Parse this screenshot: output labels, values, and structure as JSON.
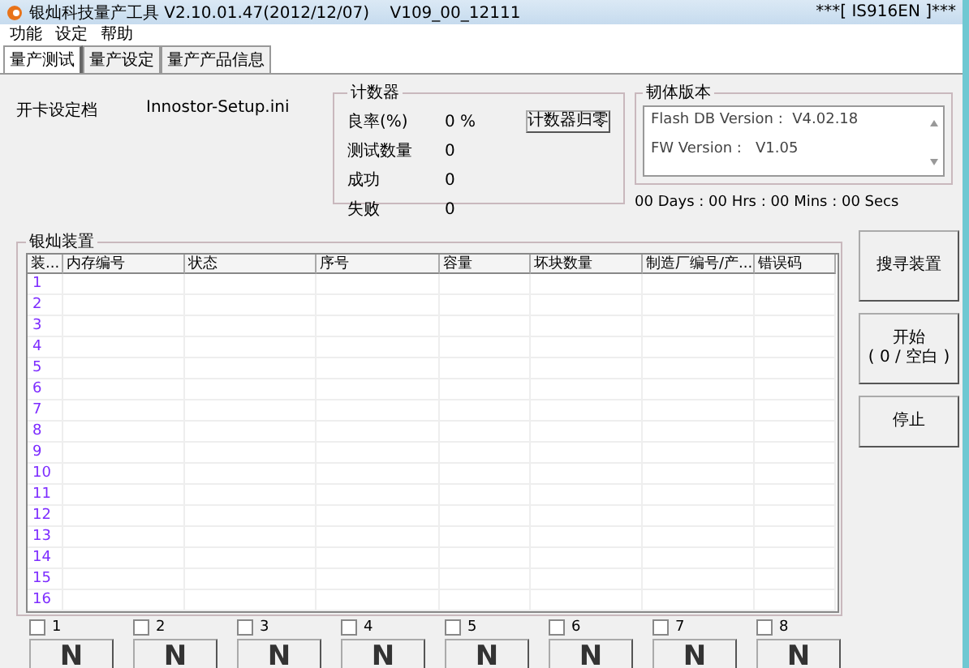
{
  "window": {
    "title": "银灿科技量产工具 V2.10.01.47(2012/12/07)    V109_00_12111",
    "title_right": "***[ IS916EN ]***"
  },
  "menu": [
    "功能",
    "设定",
    "帮助"
  ],
  "tabs": [
    {
      "label": "量产测试",
      "selected": true
    },
    {
      "label": "量产设定",
      "selected": false
    },
    {
      "label": "量产产品信息",
      "selected": false
    }
  ],
  "config": {
    "label": "开卡设定档",
    "value": "Innostor-Setup.ini"
  },
  "counter": {
    "title": "计数器",
    "reset_button": "计数器归零",
    "rows": [
      {
        "label": "良率(%)",
        "value": "0 %"
      },
      {
        "label": "测试数量",
        "value": "0"
      },
      {
        "label": "成功",
        "value": "0"
      },
      {
        "label": "失败",
        "value": "0"
      }
    ]
  },
  "firmware": {
    "title": "韧体版本",
    "lines": [
      "Flash DB Version :  V4.02.18",
      "FW Version :   V1.05"
    ]
  },
  "timer": "00 Days : 00 Hrs : 00 Mins : 00 Secs",
  "devices": {
    "title": "银灿装置",
    "columns": [
      "装...",
      "内存编号",
      "状态",
      "序号",
      "容量",
      "坏块数量",
      "制造厂编号/产...",
      "错误码"
    ],
    "rows": [
      "1",
      "2",
      "3",
      "4",
      "5",
      "6",
      "7",
      "8",
      "9",
      "10",
      "11",
      "12",
      "13",
      "14",
      "15",
      "16"
    ]
  },
  "buttons": [
    "搜寻装置",
    "开始\n( 0 / 空白 )",
    "停止"
  ],
  "slots": [
    {
      "label": "1",
      "checked": false,
      "button": "N"
    },
    {
      "label": "2",
      "checked": false,
      "button": "N"
    },
    {
      "label": "3",
      "checked": false,
      "button": "N"
    },
    {
      "label": "4",
      "checked": false,
      "button": "N"
    },
    {
      "label": "5",
      "checked": false,
      "button": "N"
    },
    {
      "label": "6",
      "checked": false,
      "button": "N"
    },
    {
      "label": "7",
      "checked": false,
      "button": "N"
    },
    {
      "label": "8",
      "checked": false,
      "button": "N"
    }
  ]
}
